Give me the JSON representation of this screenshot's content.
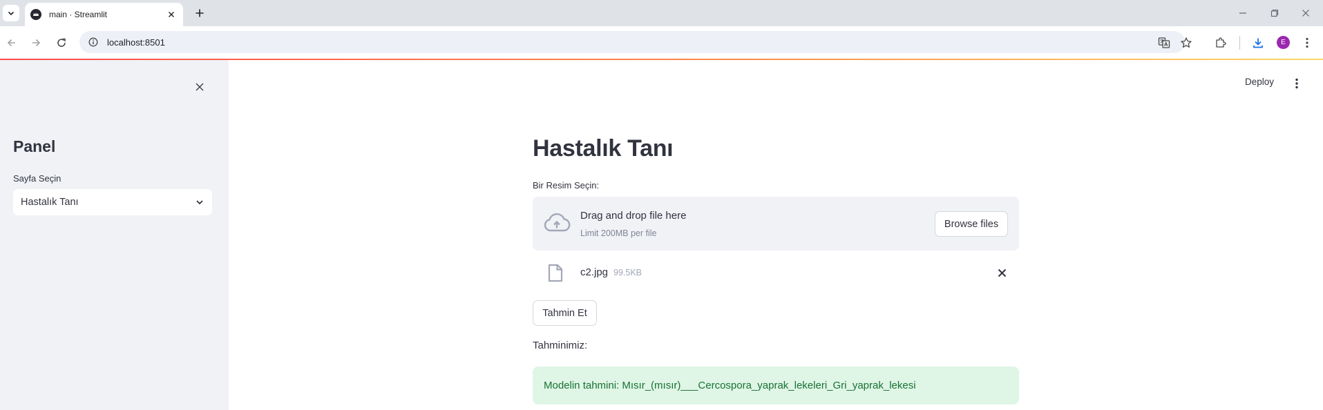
{
  "browser": {
    "tab_title": "main · Streamlit",
    "url": "localhost:8501",
    "profile_initial": "E"
  },
  "header": {
    "deploy_label": "Deploy"
  },
  "sidebar": {
    "title": "Panel",
    "select_label": "Sayfa Seçin",
    "select_value": "Hastalık Tanı"
  },
  "main": {
    "title": "Hastalık Tanı",
    "uploader": {
      "label": "Bir Resim Seçin:",
      "drop_text": "Drag and drop file here",
      "limit_text": "Limit 200MB per file",
      "browse_label": "Browse files"
    },
    "uploaded_file": {
      "name": "c2.jpg",
      "size": "99.5KB"
    },
    "predict_button_label": "Tahmin Et",
    "result_label": "Tahminimiz:",
    "result_message": "Modelin tahmini: Mısır_(mısır)___Cercospora_yaprak_lekeleri_Gri_yaprak_lekesi"
  },
  "colors": {
    "accent": "#ff4b4b",
    "sidebar_bg": "#f0f2f6",
    "success_bg": "#dff5e5",
    "success_text": "#177233",
    "profile": "#9c27b0"
  },
  "icons": {
    "tab_list": "chevron-down-icon",
    "favicon": "streamlit-crown-icon",
    "upload": "cloud-upload-icon",
    "file": "document-icon",
    "remove": "close-icon",
    "menu": "more-vertical-icon"
  }
}
